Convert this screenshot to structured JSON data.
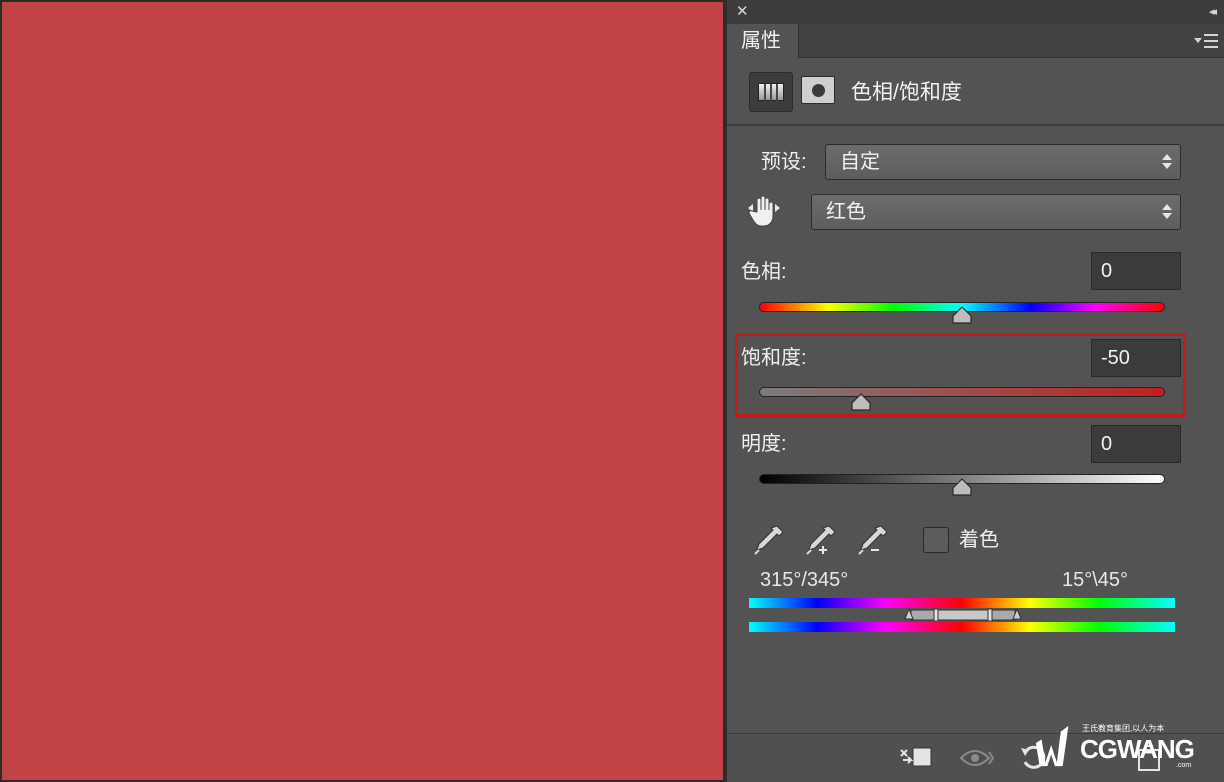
{
  "window": {
    "close_glyph": "✕",
    "collapse_glyph": "◂◂"
  },
  "panel": {
    "tab_label": "属性",
    "adjustment_title": "色相/饱和度"
  },
  "preset": {
    "label": "预设:",
    "value": "自定"
  },
  "channel": {
    "value": "红色"
  },
  "hue": {
    "label": "色相:",
    "value": "0",
    "level": 0,
    "min": -180,
    "max": 180
  },
  "saturation": {
    "label": "饱和度:",
    "value": "-50",
    "level": -50,
    "min": -100,
    "max": 100
  },
  "lightness": {
    "label": "明度:",
    "value": "0",
    "level": 0,
    "min": -100,
    "max": 100
  },
  "colorize": {
    "label": "着色",
    "checked": false
  },
  "range": {
    "left": "315°/345°",
    "right": "15°\\45°"
  },
  "watermark": {
    "tagline": "王氏教育集团,以人为本",
    "brand": "CGWANG",
    "domain": ".com"
  },
  "colors": {
    "canvas_fill": "#c24345",
    "panel_bg": "#535353",
    "highlight_box": "#c01c1c"
  },
  "icons": {
    "adjustment": "hue-saturation-adjustment-icon",
    "mask": "layer-mask-icon",
    "target_adjust": "on-image-adjust-hand-icon",
    "eyedropper": "eyedropper-icon",
    "eyedropper_add": "eyedropper-add-icon",
    "eyedropper_subtract": "eyedropper-subtract-icon",
    "clip": "clip-to-layer-icon",
    "visibility": "eye-icon",
    "reset": "reset-icon",
    "delete": "trash-icon"
  }
}
